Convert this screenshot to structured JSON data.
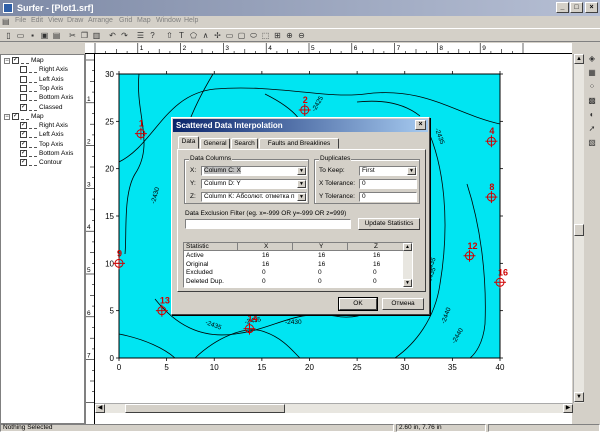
{
  "window": {
    "title": "Surfer - [Plot1.srf]",
    "minimize_label": "_",
    "maximize_label": "□",
    "close_label": "×"
  },
  "menu": [
    "File",
    "Edit",
    "View",
    "Draw",
    "Arrange",
    "Grid",
    "Map",
    "Window",
    "Help"
  ],
  "toolbar": {
    "text_tool_label": "T"
  },
  "tree": {
    "items": [
      {
        "label": "Map",
        "level": 0,
        "expander": "−",
        "checked": true
      },
      {
        "label": "Right Axis",
        "level": 1,
        "checked": false
      },
      {
        "label": "Left Axis",
        "level": 1,
        "checked": false
      },
      {
        "label": "Top Axis",
        "level": 1,
        "checked": false
      },
      {
        "label": "Bottom Axis",
        "level": 1,
        "checked": false
      },
      {
        "label": "Classed",
        "level": 1,
        "checked": true
      },
      {
        "label": "Map",
        "level": 0,
        "expander": "−",
        "checked": true
      },
      {
        "label": "Right Axis",
        "level": 1,
        "checked": true
      },
      {
        "label": "Left Axis",
        "level": 1,
        "checked": true
      },
      {
        "label": "Top Axis",
        "level": 1,
        "checked": true
      },
      {
        "label": "Bottom Axis",
        "level": 1,
        "checked": true
      },
      {
        "label": "Contour",
        "level": 1,
        "checked": true
      }
    ]
  },
  "ruler_h_labels": [
    "1",
    "2",
    "3",
    "4",
    "5",
    "6",
    "7",
    "8",
    "9"
  ],
  "ruler_v_labels": [
    "1",
    "2",
    "3",
    "4",
    "5",
    "6",
    "7"
  ],
  "map": {
    "x_ticks": [
      "0",
      "5",
      "10",
      "15",
      "20",
      "25",
      "30",
      "35",
      "40"
    ],
    "y_ticks": [
      "0",
      "5",
      "10",
      "15",
      "20",
      "25",
      "30"
    ],
    "fill_color": "#00e5f2",
    "points": [
      {
        "label": "1",
        "x": 2.3,
        "y": 23.7
      },
      {
        "label": "2",
        "x": 19.5,
        "y": 26.2
      },
      {
        "label": "4",
        "x": 39.1,
        "y": 22.9
      },
      {
        "label": "8",
        "x": 39.1,
        "y": 17.0
      },
      {
        "label": "9",
        "x": 0.0,
        "y": 10.0
      },
      {
        "label": "12",
        "x": 36.8,
        "y": 10.8
      },
      {
        "label": "13",
        "x": 4.5,
        "y": 5.0
      },
      {
        "label": "14",
        "x": 13.7,
        "y": 3.1
      },
      {
        "label": "16",
        "x": 40.0,
        "y": 8.0
      }
    ],
    "contour_labels": [
      "-2425",
      "-2435",
      "-2430",
      "-2440",
      "-2435",
      "-2435",
      "-2440",
      "-2430",
      "-2435",
      "-2435"
    ]
  },
  "dialog": {
    "title": "Scattered Data Interpolation",
    "close_label": "×",
    "tabs": [
      "Data",
      "General",
      "Search",
      "Faults and Breaklines"
    ],
    "data_columns": {
      "title": "Data Columns",
      "x_label": "X:",
      "x_value": "Column C:  X",
      "y_label": "Y:",
      "y_value": "Column D:  Y",
      "z_label": "Z:",
      "z_value": "Column K:  Абсолют. отметка п"
    },
    "duplicates": {
      "title": "Duplicates",
      "to_keep_label": "To Keep:",
      "to_keep_value": "First",
      "x_tol_label": "X Tolerance:",
      "x_tol_value": "0",
      "y_tol_label": "Y Tolerance:",
      "y_tol_value": "0"
    },
    "filter_label": "Data Exclusion Filter  (eg. x=-999 OR y=-999 OR z=999)",
    "filter_value": "",
    "update_button": "Update Statistics",
    "stats_headers": [
      "Statistic",
      "X",
      "Y",
      "Z"
    ],
    "stats_rows": [
      [
        "Active",
        "16",
        "16",
        "16"
      ],
      [
        "Original",
        "16",
        "16",
        "16"
      ],
      [
        "Excluded",
        "0",
        "0",
        "0"
      ],
      [
        "Deleted Dup.",
        "0",
        "0",
        "0"
      ]
    ],
    "ok_label": "OK",
    "cancel_label": "Отмена"
  },
  "status": {
    "message": "Nothing Selected",
    "coords": "2.60 in, 7.76 in"
  },
  "colors": {
    "titlebar_inactive": "#7e8aa6",
    "dialog_titlebar": "#0a246a",
    "map_fill": "#00e5f2",
    "marker": "#d00000"
  }
}
